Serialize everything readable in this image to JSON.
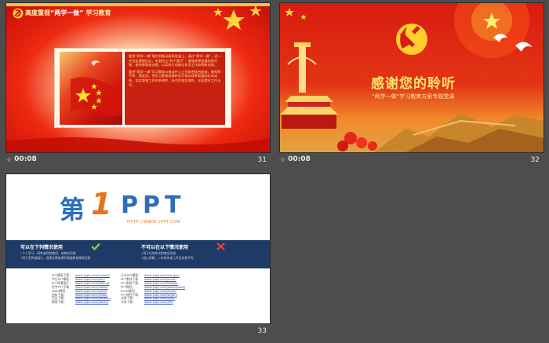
{
  "slides": [
    {
      "number": "31",
      "timer": "00:08",
      "title_prefix": "高度重视",
      "title_quote": "“两学一做”",
      "title_suffix": "学习教育",
      "paragraph1": "要把“两学一做”落实到推动改革发展上，通过“两学一做”，进一步坚定理想信念，牢固树立“四个意识”，增强改革发展的责任感、使命感和紧迫感，以实际行动推动各项工作取得新成效。",
      "paragraph2": "要把“两学一做”学习教育与推动中心工作紧密结合起来，做到两手抓、两促进，把学习教育成果转化为推动改革发展的实际成效，切实增强工作的系统性、针对性和实效性，全面提升工作水平。"
    },
    {
      "number": "32",
      "timer": "00:08",
      "thanks": "感谢您的聆听",
      "subtitle": "“两学一做”学习教育方案专题党课"
    },
    {
      "number": "33",
      "logo_di": "第",
      "logo_one": "1",
      "logo_ppt": "PPT",
      "logo_url": "HTTP://WWW.1PPT.COM",
      "allowed_heading": "可以在下列情况使用",
      "allowed_lines": [
        "•个人学习、研究或欣赏使用，非商业用途",
        "•用于宣传或展示，但需注明来源并保留原始版权信息"
      ],
      "denied_heading": "不可以在以下情况使用",
      "denied_lines": [
        "•用于任何形式的商业用途",
        "•禁止转载、二次发布或上传至其他平台"
      ],
      "links_left": [
        {
          "k": "PPT模板下载：",
          "v": "www.1ppt.com/moban/"
        },
        {
          "k": "节日PPT模板：",
          "v": "www.1ppt.com/jieri/"
        },
        {
          "k": "PPT背景图片：",
          "v": "www.1ppt.com/beijing/"
        },
        {
          "k": "优秀PPT下载：",
          "v": "www.1ppt.com/xiazai/"
        },
        {
          "k": "Word教程：",
          "v": "www.1ppt.com/word/"
        },
        {
          "k": "资料下载：",
          "v": "www.1ppt.com/ziliao/"
        },
        {
          "k": "范文下载：",
          "v": "www.1ppt.com/fanwen/"
        },
        {
          "k": "教案下载：",
          "v": "www.1ppt.com/jiaoan/"
        }
      ],
      "links_right": [
        {
          "k": "行业PPT模板：",
          "v": "www.1ppt.com/hangye/"
        },
        {
          "k": "PPT素材下载：",
          "v": "www.1ppt.com/sucai/"
        },
        {
          "k": "PPT图表下载：",
          "v": "www.1ppt.com/tubiao/"
        },
        {
          "k": "PPT教程：",
          "v": "www.1ppt.com/powerpoint/"
        },
        {
          "k": "Excel教程：",
          "v": "www.1ppt.com/excel/"
        },
        {
          "k": "PPT课件下载：",
          "v": "www.1ppt.com/kejian/"
        },
        {
          "k": "试卷下载：",
          "v": "www.1ppt.com/shiti/"
        },
        {
          "k": "字体下载：",
          "v": "www.1ppt.com/ziti/"
        }
      ]
    }
  ],
  "colors": {
    "background": "#4d4d4d",
    "party_red": "#d81c10",
    "gold": "#ffe36e",
    "logo_blue": "#2e6fb7",
    "logo_orange": "#e8731a",
    "bar_navy": "#1e3a66"
  }
}
